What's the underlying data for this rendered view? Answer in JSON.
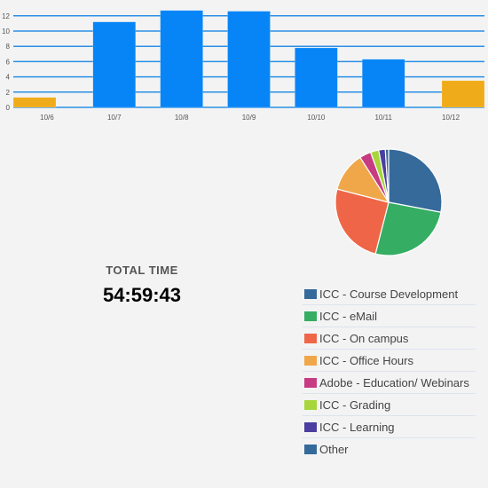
{
  "chart_data": [
    {
      "type": "bar",
      "categories": [
        "10/6",
        "10/7",
        "10/8",
        "10/9",
        "10/10",
        "10/11",
        "10/12"
      ],
      "values": [
        1.3,
        11.2,
        12.7,
        12.6,
        7.8,
        6.3,
        3.5
      ],
      "bar_colors": [
        "#f0ab1a",
        "#0785f7",
        "#0785f7",
        "#0785f7",
        "#0785f7",
        "#0785f7",
        "#f0ab1a"
      ],
      "yticks": [
        0,
        2,
        4,
        6,
        8,
        10,
        12
      ],
      "ylim": [
        0,
        12.8
      ],
      "grid": true,
      "grid_color": "#2b8fe6",
      "title": "",
      "xlabel": "",
      "ylabel": ""
    },
    {
      "type": "pie",
      "labels": [
        "ICC - Course Development",
        "ICC - eMail",
        "ICC - On campus",
        "ICC - Office Hours",
        "Adobe - Education/ Webinars",
        "ICC - Grading",
        "ICC - Learning",
        "Other"
      ],
      "values": [
        28,
        26,
        25,
        12,
        3.5,
        2.5,
        2,
        1
      ],
      "colors": [
        "#356a9b",
        "#35ad62",
        "#ee6647",
        "#efa74a",
        "#c73b82",
        "#a6d63b",
        "#4a3fa0",
        "#356a9b"
      ],
      "legend_position": "bottom"
    }
  ],
  "total": {
    "label": "TOTAL TIME",
    "value": "54:59:43"
  }
}
